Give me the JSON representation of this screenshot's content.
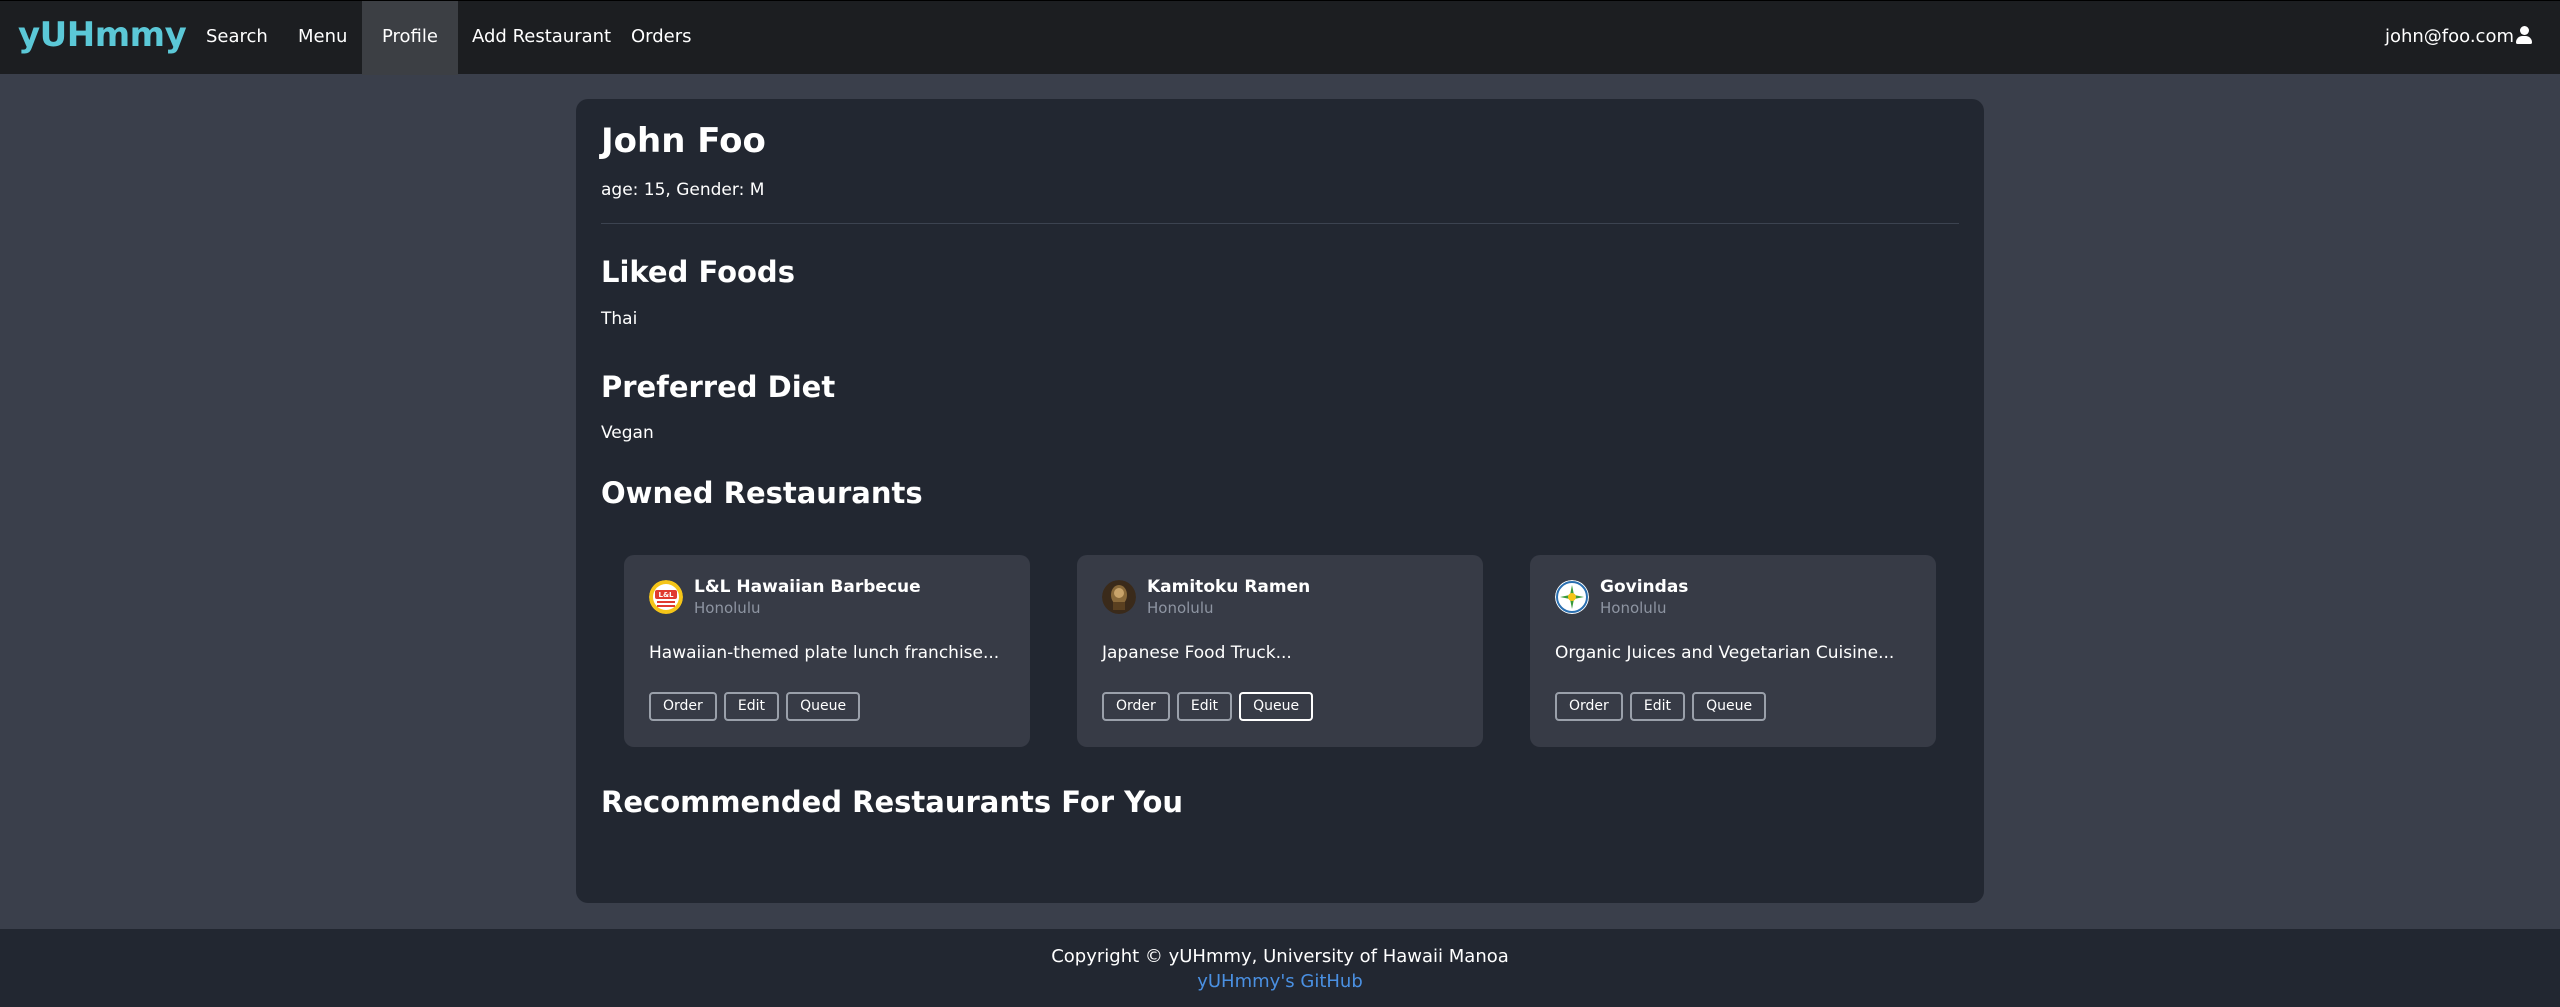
{
  "navbar": {
    "brand": "yUHmmy",
    "items": [
      {
        "label": "Search"
      },
      {
        "label": "Menu"
      },
      {
        "label": "Profile"
      },
      {
        "label": "Add Restaurant"
      },
      {
        "label": "Orders"
      }
    ],
    "active_item": "Profile",
    "user_email": "john@foo.com",
    "user_icon": "user-icon"
  },
  "profile": {
    "name": "John Foo",
    "meta": "age: 15, Gender: M",
    "liked_foods_heading": "Liked Foods",
    "liked_foods": "Thai",
    "diet_heading": "Preferred Diet",
    "diet": "Vegan",
    "owned_heading": "Owned Restaurants",
    "recommended_heading": "Recommended Restaurants For You"
  },
  "restaurants": [
    {
      "name": "L&L Hawaiian Barbecue",
      "city": "Honolulu",
      "description": "Hawaiian-themed plate lunch franchise...",
      "buttons": [
        "Order",
        "Edit",
        "Queue"
      ],
      "logo_text": "L&L"
    },
    {
      "name": "Kamitoku Ramen",
      "city": "Honolulu",
      "description": "Japanese Food Truck...",
      "buttons": [
        "Order",
        "Edit",
        "Queue"
      ]
    },
    {
      "name": "Govindas",
      "city": "Honolulu",
      "description": "Organic Juices and Vegetarian Cuisine...",
      "buttons": [
        "Order",
        "Edit",
        "Queue"
      ]
    }
  ],
  "footer": {
    "copyright": "Copyright © yUHmmy, University of Hawaii Manoa",
    "link": "yUHmmy's GitHub"
  },
  "colors": {
    "brand": "#5bc8d7",
    "navbar_bg": "#1c1e21",
    "page_bg": "#3a3f4b",
    "panel_bg": "#222731",
    "card_bg": "#373b46",
    "link": "#4a90e2"
  }
}
